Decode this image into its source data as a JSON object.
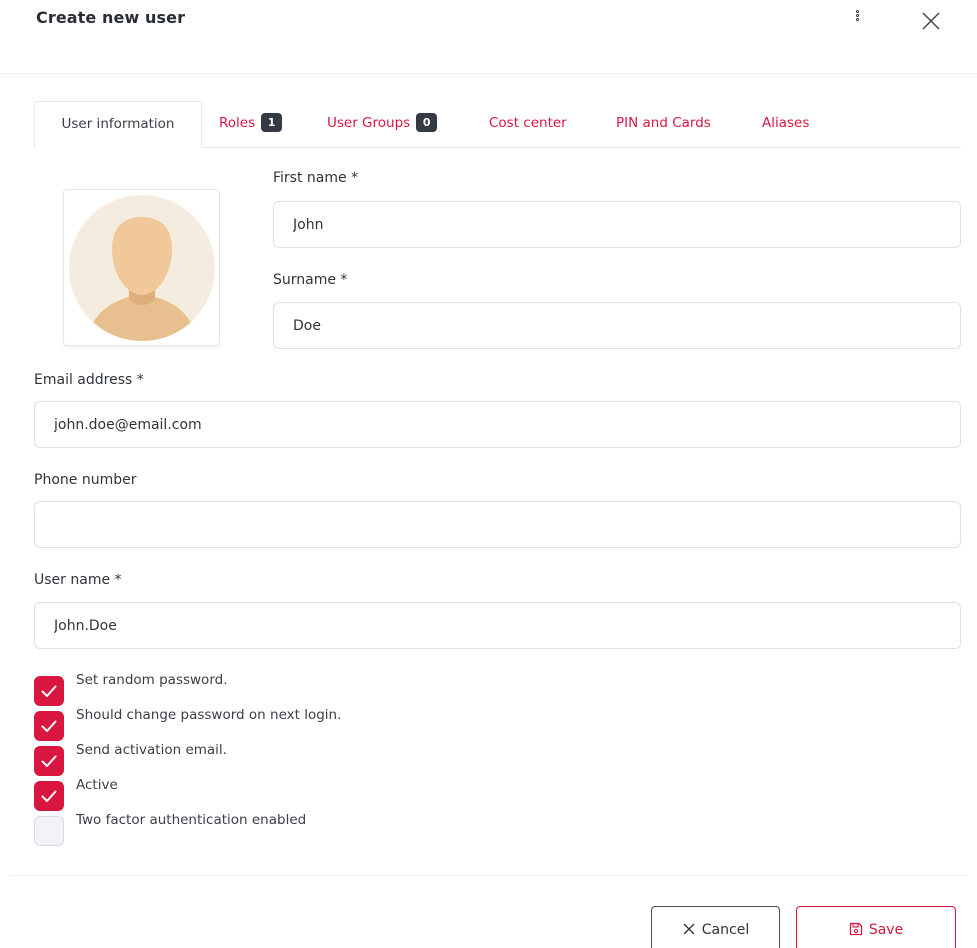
{
  "dialog": {
    "title": "Create new user"
  },
  "tabs": [
    {
      "label": "User information",
      "active": true
    },
    {
      "label": "Roles",
      "badge": "1"
    },
    {
      "label": "User Groups",
      "badge": "0"
    },
    {
      "label": "Cost center"
    },
    {
      "label": "PIN and Cards"
    },
    {
      "label": "Aliases"
    }
  ],
  "form": {
    "first_name": {
      "label": "First name *",
      "value": "John"
    },
    "surname": {
      "label": "Surname *",
      "value": "Doe"
    },
    "email": {
      "label": "Email address *",
      "value": "john.doe@email.com"
    },
    "phone": {
      "label": "Phone number",
      "value": ""
    },
    "username": {
      "label": "User name *",
      "value": "John.Doe"
    }
  },
  "options": [
    {
      "label": "Set random password.",
      "checked": true
    },
    {
      "label": "Should change password on next login.",
      "checked": true
    },
    {
      "label": "Send activation email.",
      "checked": true
    },
    {
      "label": "Active",
      "checked": true
    },
    {
      "label": "Two factor authentication enabled",
      "checked": false
    }
  ],
  "footer": {
    "cancel_label": "Cancel",
    "save_label": "Save"
  },
  "colors": {
    "accent": "#d9163f",
    "badge": "#343a44",
    "text": "#2f333a",
    "border": "#dde0e5"
  },
  "icons": {
    "menu": "kebab-icon",
    "close": "close-icon",
    "avatar": "user-silhouette-icon",
    "check": "check-icon",
    "cancel": "x-icon",
    "save": "floppy-disk-icon"
  }
}
